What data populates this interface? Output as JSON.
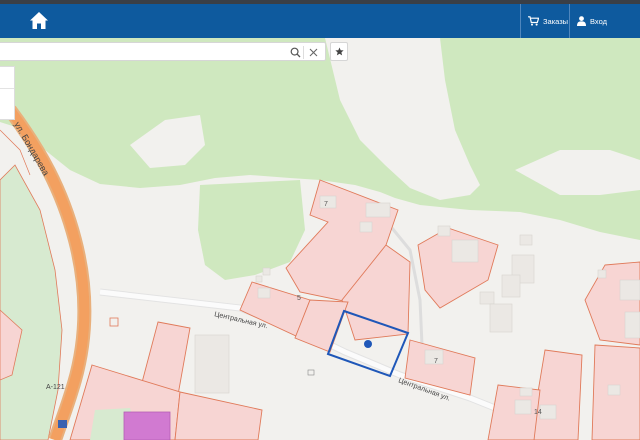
{
  "navbar": {
    "orders_label": "Заказы",
    "login_label": "Вход",
    "bg_color": "#0e5a9e"
  },
  "search": {
    "value": "",
    "placeholder": ""
  },
  "icons": {
    "home": "home-icon",
    "cart": "shopping-cart-icon",
    "user": "user-icon",
    "search": "search-icon",
    "clear": "close-icon",
    "favorite": "star-icon"
  },
  "map": {
    "street_labels": {
      "bondareva": "ул. Бондарева",
      "centralnaya_1": "Центральная ул.",
      "centralnaya_2": "Центральная ул."
    },
    "road_labels": {
      "a121": "А-121"
    },
    "house_numbers": {
      "h7_top": "7",
      "h5": "5",
      "h7_bottom": "7",
      "h14": "14"
    },
    "colors": {
      "forest": "#cfe8bf",
      "parcel_fill": "#f7d5d3",
      "parcel_stroke": "#e07a5a",
      "highway": "#f3a060",
      "selected_parcel": "#1f57b8"
    }
  }
}
